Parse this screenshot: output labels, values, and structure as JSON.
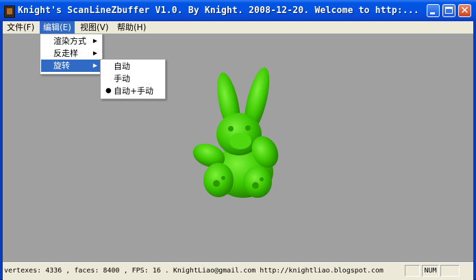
{
  "window": {
    "title": "Knight's ScanLineZbuffer V1.0. By Knight. 2008-12-20.  Welcome to http:...",
    "close_glyph": "✕"
  },
  "menubar": {
    "items": [
      "文件(F)",
      "编辑(E)",
      "视图(V)",
      "帮助(H)"
    ]
  },
  "edit_menu": {
    "items": [
      {
        "label": "渲染方式",
        "submenu": true
      },
      {
        "label": "反走样",
        "submenu": true
      },
      {
        "label": "旋转",
        "submenu": true,
        "active": true
      }
    ],
    "arrow": "▶"
  },
  "rotate_submenu": {
    "items": [
      {
        "label": "自动",
        "checked": false
      },
      {
        "label": "手动",
        "checked": false
      },
      {
        "label": "自动+手动",
        "checked": true
      }
    ],
    "bullet": "●"
  },
  "viewport": {
    "model": "bunny",
    "model_color": "#3cc800",
    "background": "#a0a0a0"
  },
  "statusbar": {
    "text": "vertexes: 4336 , faces: 8400 , FPS: 16 .   KnightLiao@gmail.com   http://knightliao.blogspot.com",
    "panes": [
      "",
      "NUM",
      ""
    ]
  }
}
